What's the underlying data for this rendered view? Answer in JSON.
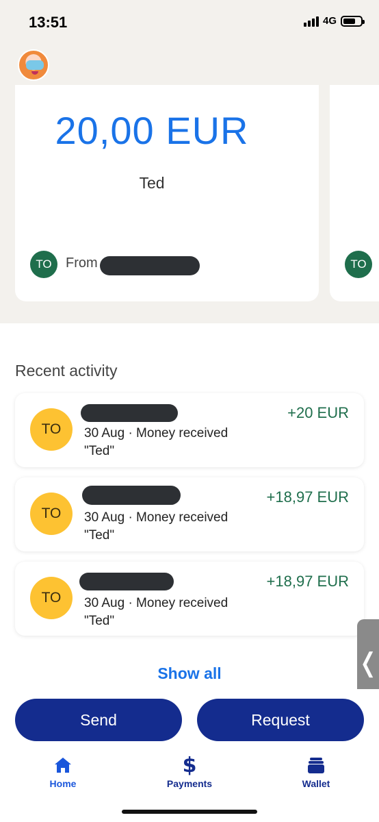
{
  "status_bar": {
    "time": "13:51",
    "network": "4G"
  },
  "payment_card": {
    "amount": "20,00 EUR",
    "note": "Ted",
    "initials": "TO",
    "from_label": "From",
    "next_card_initials": "TO"
  },
  "recent_activity": {
    "title": "Recent activity",
    "items": [
      {
        "initials": "TO",
        "detail": "30 Aug · Money received",
        "note": "\"Ted\"",
        "amount": "+20 EUR"
      },
      {
        "initials": "TO",
        "detail": "30 Aug · Money received",
        "note": "\"Ted\"",
        "amount": "+18,97 EUR"
      },
      {
        "initials": "TO",
        "detail": "30 Aug · Money received",
        "note": "\"Ted\"",
        "amount": "+18,97 EUR"
      }
    ],
    "show_all": "Show all"
  },
  "actions": {
    "send": "Send",
    "request": "Request"
  },
  "side_handle": {
    "glyph": "❬"
  },
  "nav": {
    "items": [
      {
        "label": "Home",
        "icon": "home-icon"
      },
      {
        "label": "Payments",
        "icon": "dollar-icon"
      },
      {
        "label": "Wallet",
        "icon": "wallet-icon"
      }
    ]
  },
  "colors": {
    "accent": "#1a73e8",
    "button": "#142c8e",
    "positive": "#1f6e4c",
    "avatar_yellow": "#fdc232"
  }
}
